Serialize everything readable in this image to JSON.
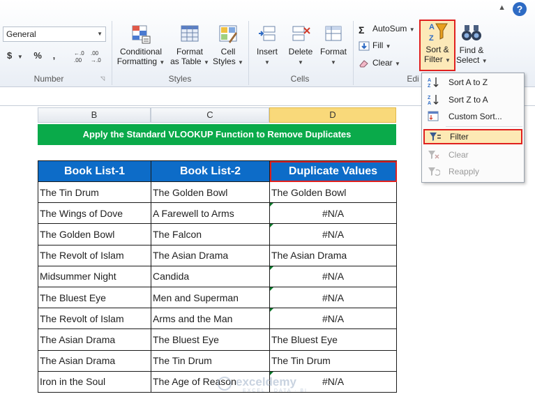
{
  "ribbon": {
    "number_format": "General",
    "number_symbols": [
      "$",
      "%",
      ","
    ],
    "decimal_increase": "+.0\n.00",
    "decimal_decrease": ".00\n+.0",
    "group_number": "Number",
    "group_styles": "Styles",
    "group_cells": "Cells",
    "group_editing": "Edi",
    "conditional_formatting": [
      "Conditional",
      "Formatting"
    ],
    "format_as_table": [
      "Format",
      "as Table"
    ],
    "cell_styles": [
      "Cell",
      "Styles"
    ],
    "insert": "Insert",
    "delete": "Delete",
    "format": "Format",
    "autosum": "AutoSum",
    "fill": "Fill",
    "clear": "Clear",
    "sort_filter": [
      "Sort &",
      "Filter"
    ],
    "find_select": [
      "Find &",
      "Select"
    ],
    "help": "?"
  },
  "columns": [
    "B",
    "C",
    "D"
  ],
  "sheet": {
    "title": "Apply the Standard VLOOKUP Function to Remove Duplicates",
    "headers": [
      "Book List-1",
      "Book List-2",
      "Duplicate Values"
    ],
    "rows": [
      [
        "The Tin Drum",
        "The Golden Bowl",
        "The Golden Bowl"
      ],
      [
        "The Wings of Dove",
        "A Farewell to Arms",
        "#N/A"
      ],
      [
        "The Golden Bowl",
        "The Falcon",
        "#N/A"
      ],
      [
        "The Revolt of Islam",
        "The Asian Drama",
        "The Asian Drama"
      ],
      [
        "Midsummer Night",
        "Candida",
        "#N/A"
      ],
      [
        "The Bluest Eye",
        "Men and Superman",
        "#N/A"
      ],
      [
        "The Revolt of Islam",
        "Arms and the Man",
        "#N/A"
      ],
      [
        "The Asian Drama",
        "The Bluest Eye",
        "The Bluest Eye"
      ],
      [
        "The Asian Drama",
        "The Tin Drum",
        "The Tin Drum"
      ],
      [
        "Iron in the Soul",
        "The Age of Reason",
        "#N/A"
      ]
    ]
  },
  "menu": {
    "sort_az": "Sort A to Z",
    "sort_za": "Sort Z to A",
    "custom_sort": "Custom Sort...",
    "filter": "Filter",
    "clear": "Clear",
    "reapply": "Reapply"
  },
  "watermark": {
    "name": "exceldemy",
    "tagline": "EXCEL · DATA · BI"
  },
  "colors": {
    "title_green": "#0aaa4a",
    "header_blue": "#0d6cc8",
    "highlight_red": "#e0201e",
    "active_col": "#f9d97a"
  }
}
